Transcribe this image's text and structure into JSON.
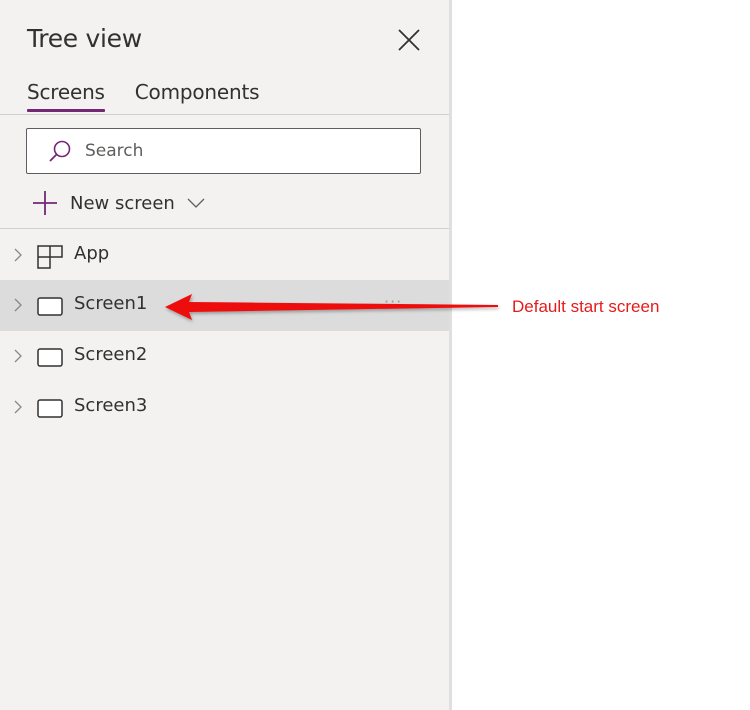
{
  "panel": {
    "title": "Tree view",
    "close_icon": "close-icon",
    "tabs": [
      {
        "label": "Screens",
        "active": true
      },
      {
        "label": "Components",
        "active": false
      }
    ],
    "search": {
      "placeholder": "Search",
      "value": "",
      "icon": "search-icon"
    },
    "new_screen": {
      "label": "New screen",
      "icon": "plus-icon",
      "dropdown_icon": "chevron-down-icon"
    },
    "items": [
      {
        "label": "App",
        "icon": "app-grid-icon",
        "selected": false
      },
      {
        "label": "Screen1",
        "icon": "screen-icon",
        "selected": true,
        "more": "···"
      },
      {
        "label": "Screen2",
        "icon": "screen-icon",
        "selected": false
      },
      {
        "label": "Screen3",
        "icon": "screen-icon",
        "selected": false
      }
    ]
  },
  "annotation": {
    "text": "Default start screen",
    "color": "#e31b1b"
  },
  "colors": {
    "accent": "#742774",
    "panel_bg": "#f3f2f1",
    "selected_bg": "#dcdcdc"
  }
}
